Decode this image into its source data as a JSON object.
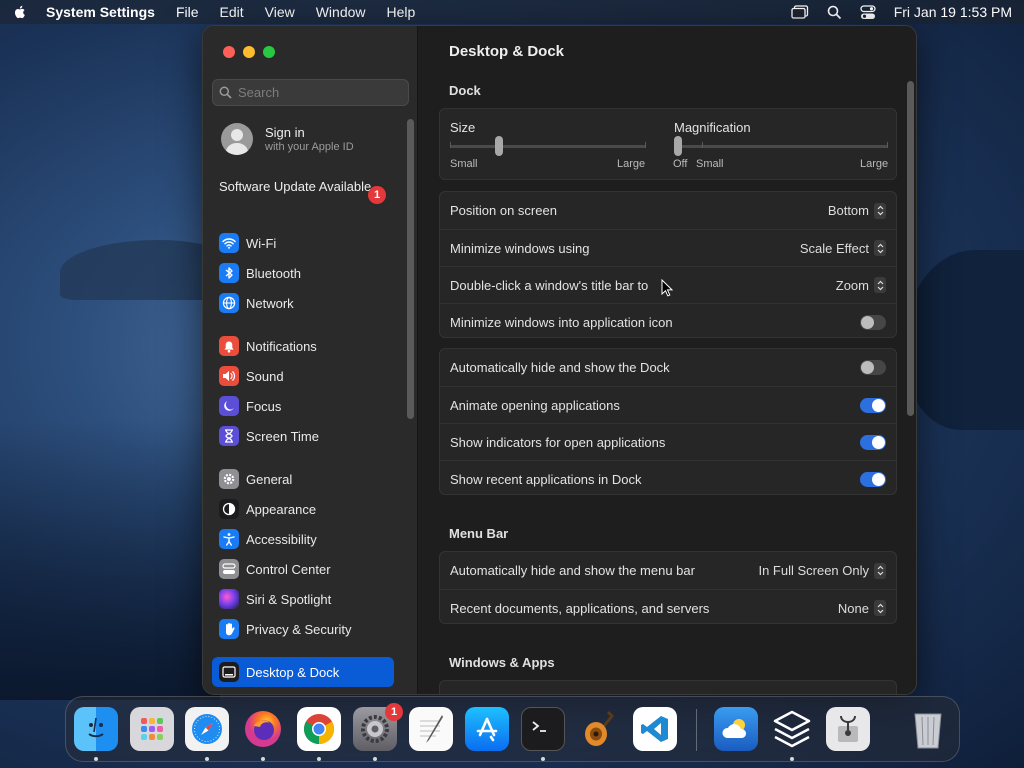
{
  "menubar": {
    "app_name": "System Settings",
    "items": [
      "File",
      "Edit",
      "View",
      "Window",
      "Help"
    ],
    "clock": "Fri Jan 19  1:53 PM"
  },
  "sidebar": {
    "search_placeholder": "Search",
    "signin_title": "Sign in",
    "signin_subtitle": "with your Apple ID",
    "update_text": "Software Update Available",
    "update_badge": "1",
    "items": [
      {
        "label": "Wi-Fi",
        "icon": "wifi-icon",
        "color": "#1a7cf5"
      },
      {
        "label": "Bluetooth",
        "icon": "bluetooth-icon",
        "color": "#1a7cf5"
      },
      {
        "label": "Network",
        "icon": "globe-icon",
        "color": "#1a7cf5"
      },
      {
        "label": "Notifications",
        "icon": "bell-icon",
        "color": "#eb4d3d"
      },
      {
        "label": "Sound",
        "icon": "speaker-icon",
        "color": "#eb4d3d"
      },
      {
        "label": "Focus",
        "icon": "moon-icon",
        "color": "#5b4fd8"
      },
      {
        "label": "Screen Time",
        "icon": "hourglass-icon",
        "color": "#5b4fd8"
      },
      {
        "label": "General",
        "icon": "gear-icon",
        "color": "#8e8e93"
      },
      {
        "label": "Appearance",
        "icon": "appearance-icon",
        "color": "#1c1c1e"
      },
      {
        "label": "Accessibility",
        "icon": "accessibility-icon",
        "color": "#1a7cf5"
      },
      {
        "label": "Control Center",
        "icon": "control-center-icon",
        "color": "#8e8e93"
      },
      {
        "label": "Siri & Spotlight",
        "icon": "siri-icon",
        "color": "#7a3fd1"
      },
      {
        "label": "Privacy & Security",
        "icon": "hand-icon",
        "color": "#1a7cf5"
      },
      {
        "label": "Desktop & Dock",
        "icon": "dock-icon",
        "color": "#1c1c1e"
      }
    ]
  },
  "content": {
    "title": "Desktop & Dock",
    "dock_section": "Dock",
    "size_label": "Size",
    "size_min": "Small",
    "size_max": "Large",
    "size_value": 0.25,
    "mag_label": "Magnification",
    "mag_off": "Off",
    "mag_min": "Small",
    "mag_max": "Large",
    "mag_value": 0.0,
    "rows_a": [
      {
        "label": "Position on screen",
        "value": "Bottom"
      },
      {
        "label": "Minimize windows using",
        "value": "Scale Effect"
      },
      {
        "label": "Double-click a window's title bar to",
        "value": "Zoom"
      }
    ],
    "minimize_into_icon": "Minimize windows into application icon",
    "rows_b": [
      {
        "label": "Automatically hide and show the Dock",
        "on": false
      },
      {
        "label": "Animate opening applications",
        "on": true
      },
      {
        "label": "Show indicators for open applications",
        "on": true
      },
      {
        "label": "Show recent applications in Dock",
        "on": true
      }
    ],
    "menubar_section": "Menu Bar",
    "menubar_rows": [
      {
        "label": "Automatically hide and show the menu bar",
        "value": "In Full Screen Only"
      },
      {
        "label": "Recent documents, applications, and servers",
        "value": "None"
      }
    ],
    "windows_section": "Windows & Apps"
  },
  "dock": {
    "settings_badge": "1",
    "apps": [
      "finder",
      "launchpad",
      "safari",
      "firefox",
      "chrome",
      "system-settings",
      "textedit",
      "app-store",
      "terminal",
      "garageband",
      "vscode",
      "weather",
      "cube-app",
      "disk-utility",
      "trash"
    ]
  },
  "colors": {
    "accent": "#0a5bd6",
    "toggle_on": "#2c70e0"
  }
}
